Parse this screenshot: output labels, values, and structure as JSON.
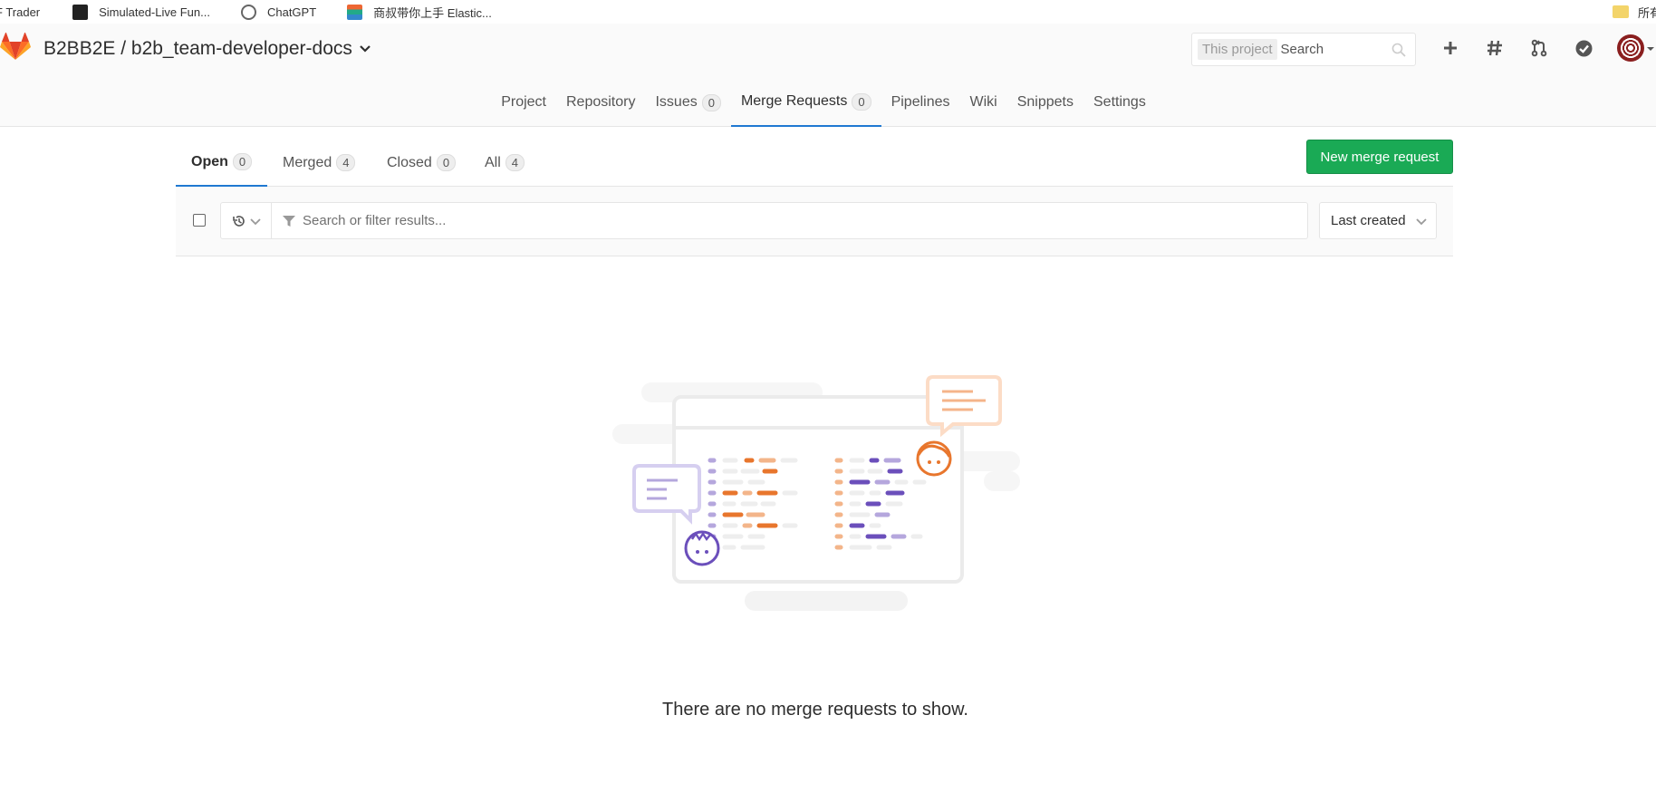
{
  "bookmarks": [
    {
      "label": "F Trader"
    },
    {
      "label": "Simulated-Live Fun..."
    },
    {
      "label": "ChatGPT"
    },
    {
      "label": "商叔带你上手 Elastic..."
    }
  ],
  "bookmarks_right": {
    "label": "所有"
  },
  "header": {
    "project_title": "B2BB2E / b2b_team-developer-docs",
    "search_scope": "This project",
    "search_placeholder": "Search"
  },
  "nav": {
    "items": [
      {
        "label": "Project"
      },
      {
        "label": "Repository"
      },
      {
        "label": "Issues",
        "count": "0"
      },
      {
        "label": "Merge Requests",
        "count": "0",
        "active": true
      },
      {
        "label": "Pipelines"
      },
      {
        "label": "Wiki"
      },
      {
        "label": "Snippets"
      },
      {
        "label": "Settings"
      }
    ]
  },
  "tabs": [
    {
      "label": "Open",
      "count": "0",
      "active": true
    },
    {
      "label": "Merged",
      "count": "4"
    },
    {
      "label": "Closed",
      "count": "0"
    },
    {
      "label": "All",
      "count": "4"
    }
  ],
  "new_button": "New merge request",
  "filter": {
    "placeholder": "Search or filter results..."
  },
  "sort": {
    "selected": "Last created"
  },
  "empty_state": "There are no merge requests to show.",
  "colors": {
    "accent_blue": "#1f78d1",
    "success_green": "#1aaa55",
    "orange": "#e8762d",
    "purple": "#6b4fbb"
  }
}
